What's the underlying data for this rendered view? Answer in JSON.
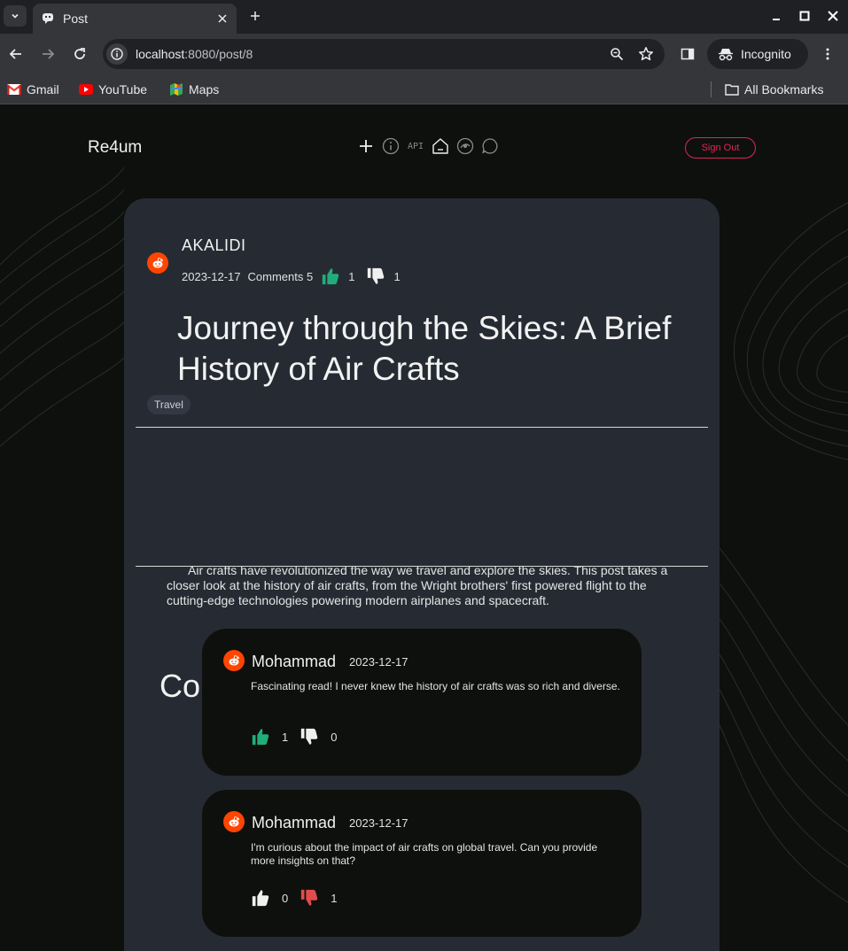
{
  "browser": {
    "tab_title": "Post",
    "url_host": "localhost",
    "url_path": ":8080/post/8",
    "incognito_label": "Incognito",
    "bookmarks": [
      "Gmail",
      "YouTube",
      "Maps"
    ],
    "all_bookmarks": "All Bookmarks"
  },
  "header": {
    "brand": "Re4um",
    "api_label": "API",
    "signout": "Sign Out"
  },
  "post": {
    "author": "AKALIDI",
    "date": "2023-12-17",
    "comments_label": "Comments 5",
    "likes": "1",
    "dislikes": "1",
    "title": "Journey through the Skies: A Brief History of Air Crafts",
    "tag": "Travel",
    "body": "Air crafts have revolutionized the way we travel and explore the skies. This post takes a closer look at the history of air crafts, from the Wright brothers' first powered flight to the cutting-edge technologies powering modern airplanes and spacecraft."
  },
  "comments_heading": "Comments",
  "comments": [
    {
      "author": "Mohammad",
      "date": "2023-12-17",
      "text": "Fascinating read! I never knew the history of air crafts was so rich and diverse.",
      "likes": "1",
      "dislikes": "0",
      "liked": true,
      "disliked": false
    },
    {
      "author": "Mohammad",
      "date": "2023-12-17",
      "text": "I'm curious about the impact of air crafts on global travel. Can you provide more insights on that?",
      "likes": "0",
      "dislikes": "1",
      "liked": false,
      "disliked": true
    }
  ],
  "colors": {
    "like_active": "#1fae7a",
    "dislike_active": "#e24c4c",
    "neutral": "#f0f0f0",
    "accent": "#e0245e",
    "avatar": "#ff4500"
  }
}
